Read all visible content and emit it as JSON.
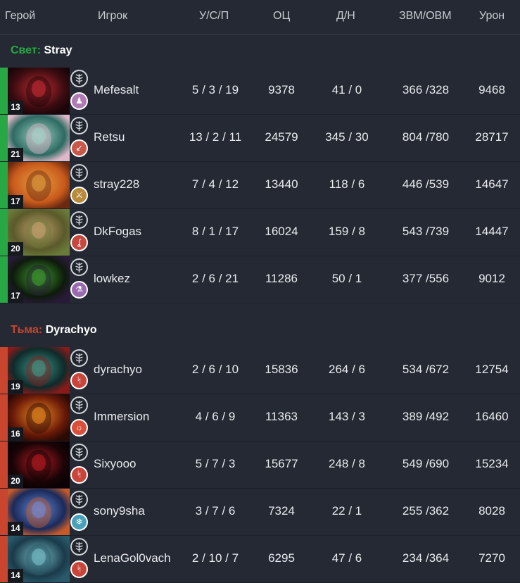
{
  "columns": {
    "hero": "Герой",
    "player": "Игрок",
    "kda": "У/С/П",
    "points": "ОЦ",
    "lh_dn": "Д/Н",
    "gpm_xpm": "ЗВМ/ОВМ",
    "damage": "Урон"
  },
  "radiant": {
    "label": "Свет:",
    "captain": "Stray",
    "color": "#27a844",
    "players": [
      {
        "level": "13",
        "name": "Mefesalt",
        "kda": "5 / 3 / 19",
        "points": "9378",
        "lh_dn": "41 / 0",
        "gpm_xpm": "366 /328",
        "damage": "9468",
        "facet_color": "#b07ab5",
        "facet_icon": "person-icon",
        "portrait": [
          "#3a0c10",
          "#c42a32",
          "#1a0508"
        ]
      },
      {
        "level": "21",
        "name": "Retsu",
        "kda": "13 / 2 / 11",
        "points": "24579",
        "lh_dn": "345 / 30",
        "gpm_xpm": "804 /780",
        "damage": "28717",
        "facet_color": "#c8584a",
        "facet_icon": "arrow-icon",
        "portrait": [
          "#2d6a62",
          "#9cd0c4",
          "#e0b8c8"
        ]
      },
      {
        "level": "17",
        "name": "stray228",
        "kda": "7 / 4 / 12",
        "points": "13440",
        "lh_dn": "118 / 6",
        "gpm_xpm": "446 /539",
        "damage": "14647",
        "facet_color": "#b88a3c",
        "facet_icon": "sword-icon",
        "portrait": [
          "#c85a1c",
          "#e8a040",
          "#6a2a10"
        ]
      },
      {
        "level": "20",
        "name": "DkFogas",
        "kda": "8 / 1 / 17",
        "points": "16024",
        "lh_dn": "159 / 8",
        "gpm_xpm": "543 /739",
        "damage": "14447",
        "facet_color": "#c44a40",
        "facet_icon": "hook-icon",
        "portrait": [
          "#5a5a2a",
          "#c8a070",
          "#6a7a3a"
        ]
      },
      {
        "level": "17",
        "name": "lowkez",
        "kda": "2 / 6 / 21",
        "points": "11286",
        "lh_dn": "50 / 1",
        "gpm_xpm": "377 /556",
        "damage": "9012",
        "facet_color": "#9a6ab0",
        "facet_icon": "flask-icon",
        "portrait": [
          "#0e1a0c",
          "#3aa02a",
          "#2a1a3a"
        ]
      }
    ]
  },
  "dire": {
    "label": "Тьма:",
    "captain": "Dyrachyo",
    "color": "#c9452e",
    "players": [
      {
        "level": "19",
        "name": "dyrachyo",
        "kda": "2 / 6 / 10",
        "points": "15836",
        "lh_dn": "264 / 6",
        "gpm_xpm": "534 /672",
        "damage": "12754",
        "facet_color": "#c9453a",
        "facet_icon": "claw-icon",
        "portrait": [
          "#0e2a2a",
          "#3a9a8a",
          "#8a1a1a"
        ]
      },
      {
        "level": "16",
        "name": "Immersion",
        "kda": "4 / 6 / 9",
        "points": "11363",
        "lh_dn": "143 / 3",
        "gpm_xpm": "389 /492",
        "damage": "16460",
        "facet_color": "#d8503a",
        "facet_icon": "sun-icon",
        "portrait": [
          "#6a1a08",
          "#f08a20",
          "#2a0a04"
        ]
      },
      {
        "level": "20",
        "name": "Sixyooo",
        "kda": "5 / 7 / 3",
        "points": "15677",
        "lh_dn": "248 / 8",
        "gpm_xpm": "549 /690",
        "damage": "15234",
        "facet_color": "#c9453a",
        "facet_icon": "claw-icon",
        "portrait": [
          "#1a0406",
          "#b81a22",
          "#0a0204"
        ]
      },
      {
        "level": "14",
        "name": "sony9sha",
        "kda": "3 / 7 / 6",
        "points": "7324",
        "lh_dn": "22 / 1",
        "gpm_xpm": "255 /362",
        "damage": "8028",
        "facet_color": "#4aa0b8",
        "facet_icon": "snowflake-icon",
        "portrait": [
          "#1a2a5a",
          "#6a8ad8",
          "#c85a2a"
        ]
      },
      {
        "level": "14",
        "name": "LenaGol0vach",
        "kda": "2 / 10 / 7",
        "points": "6295",
        "lh_dn": "47 / 6",
        "gpm_xpm": "234 /364",
        "damage": "7270",
        "facet_color": "#c9453a",
        "facet_icon": "claw-icon",
        "portrait": [
          "#1a3a4a",
          "#7ac0c8",
          "#2a5a6a"
        ]
      }
    ]
  }
}
